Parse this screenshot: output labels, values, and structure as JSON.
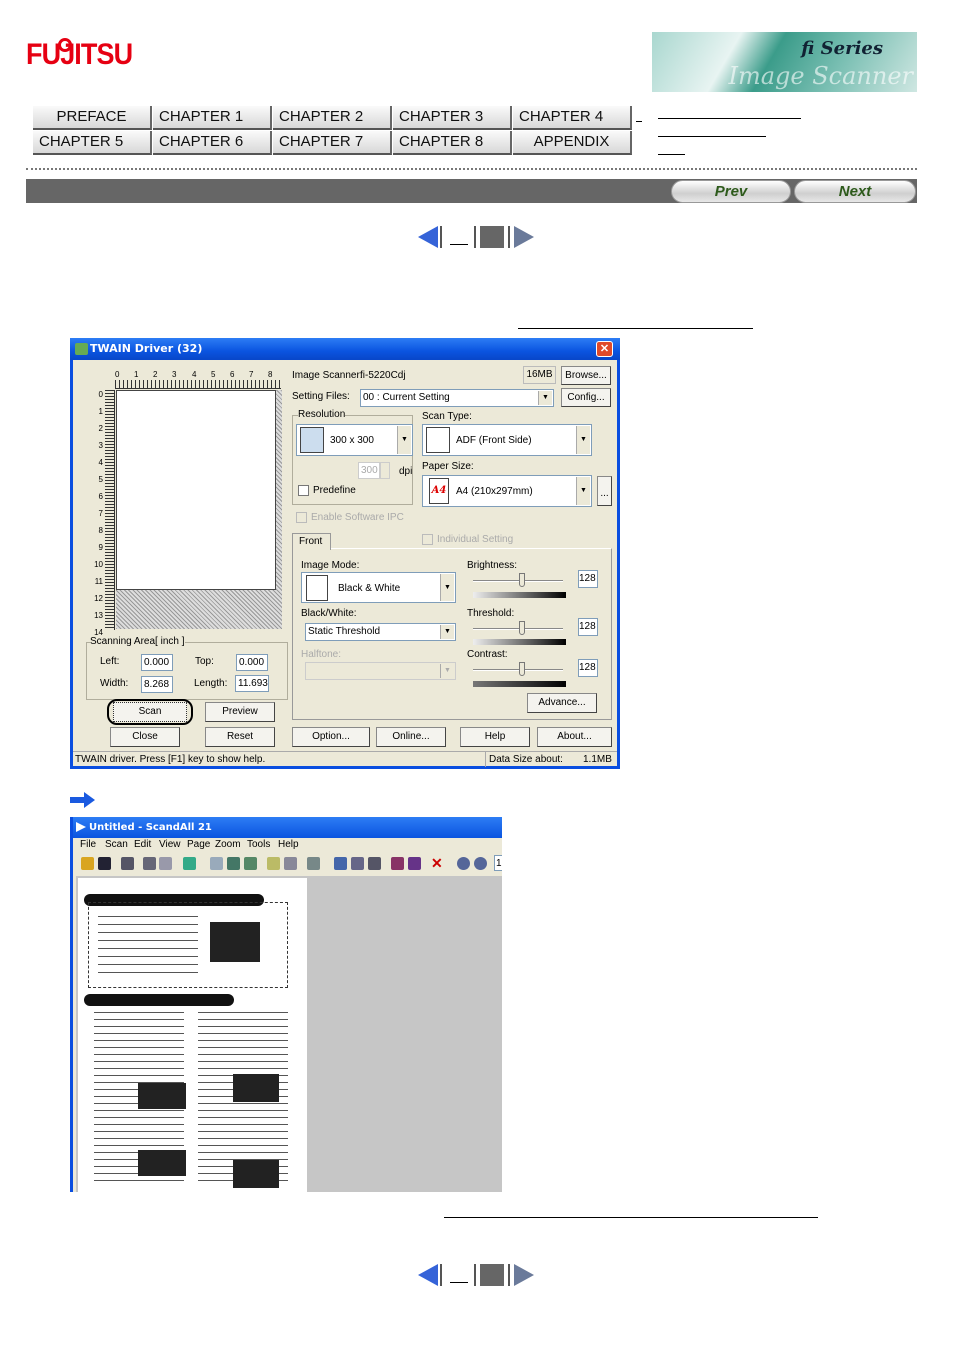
{
  "header": {
    "logo_text": "FUJITSU",
    "banner_text": {
      "series": "fi Series",
      "product": "Image Scanner"
    }
  },
  "nav": {
    "row1": [
      "PREFACE",
      "CHAPTER 1",
      "CHAPTER 2",
      "CHAPTER 3",
      "CHAPTER 4"
    ],
    "row2": [
      "CHAPTER 5",
      "CHAPTER 6",
      "CHAPTER 7",
      "CHAPTER 8",
      "APPENDIX"
    ]
  },
  "toolbar": {
    "prev": "Prev",
    "next": "Next"
  },
  "twain": {
    "title": "TWAIN Driver (32)",
    "close_icon": "close-icon",
    "ruler_h": [
      "0",
      "1",
      "2",
      "3",
      "4",
      "5",
      "6",
      "7",
      "8"
    ],
    "ruler_v": [
      "0",
      "1",
      "2",
      "3",
      "4",
      "5",
      "6",
      "7",
      "8",
      "9",
      "10",
      "11",
      "12",
      "13",
      "14"
    ],
    "scanning_area": {
      "title": "Scanning Area[ inch ]",
      "left_label": "Left:",
      "left": "0.000",
      "top_label": "Top:",
      "top": "0.000",
      "width_label": "Width:",
      "width": "8.268",
      "length_label": "Length:",
      "length": "11.693"
    },
    "buttons": {
      "scan": "Scan",
      "preview": "Preview",
      "close": "Close",
      "reset": "Reset",
      "option": "Option...",
      "online": "Online...",
      "help": "Help",
      "about": "About...",
      "browse": "Browse...",
      "config": "Config...",
      "advance": "Advance...",
      "more": "..."
    },
    "image_scanner_label": "Image Scanner:",
    "image_scanner": "fi-5220Cdj",
    "memory": "16MB",
    "setting_files_label": "Setting Files:",
    "setting_files": "00 : Current Setting",
    "resolution_label": "Resolution",
    "resolution": "300 x 300",
    "dpi_value": "300",
    "dpi_label": "dpi",
    "predefine": "Predefine",
    "scan_type_label": "Scan Type:",
    "scan_type": "ADF (Front Side)",
    "paper_size_label": "Paper Size:",
    "paper_size": "A4 (210x297mm)",
    "paper_icon_text": "A4",
    "enable_ipc": "Enable Software IPC",
    "tab_front": "Front",
    "individual_setting": "Individual Setting",
    "image_mode_label": "Image Mode:",
    "image_mode": "Black & White",
    "bw_label": "Black/White:",
    "bw": "Static Threshold",
    "halftone_label": "Halftone:",
    "brightness_label": "Brightness:",
    "brightness": "128",
    "threshold_label": "Threshold:",
    "threshold": "128",
    "contrast_label": "Contrast:",
    "contrast": "128",
    "status": "TWAIN driver. Press [F1] key to show help.",
    "data_size_label": "Data Size about:",
    "data_size": "1.1MB"
  },
  "scandall": {
    "title": "Untitled - ScandAll 21",
    "menu": [
      "File",
      "Scan",
      "Edit",
      "View",
      "Page",
      "Zoom",
      "Tools",
      "Help"
    ],
    "page_box": "1"
  }
}
